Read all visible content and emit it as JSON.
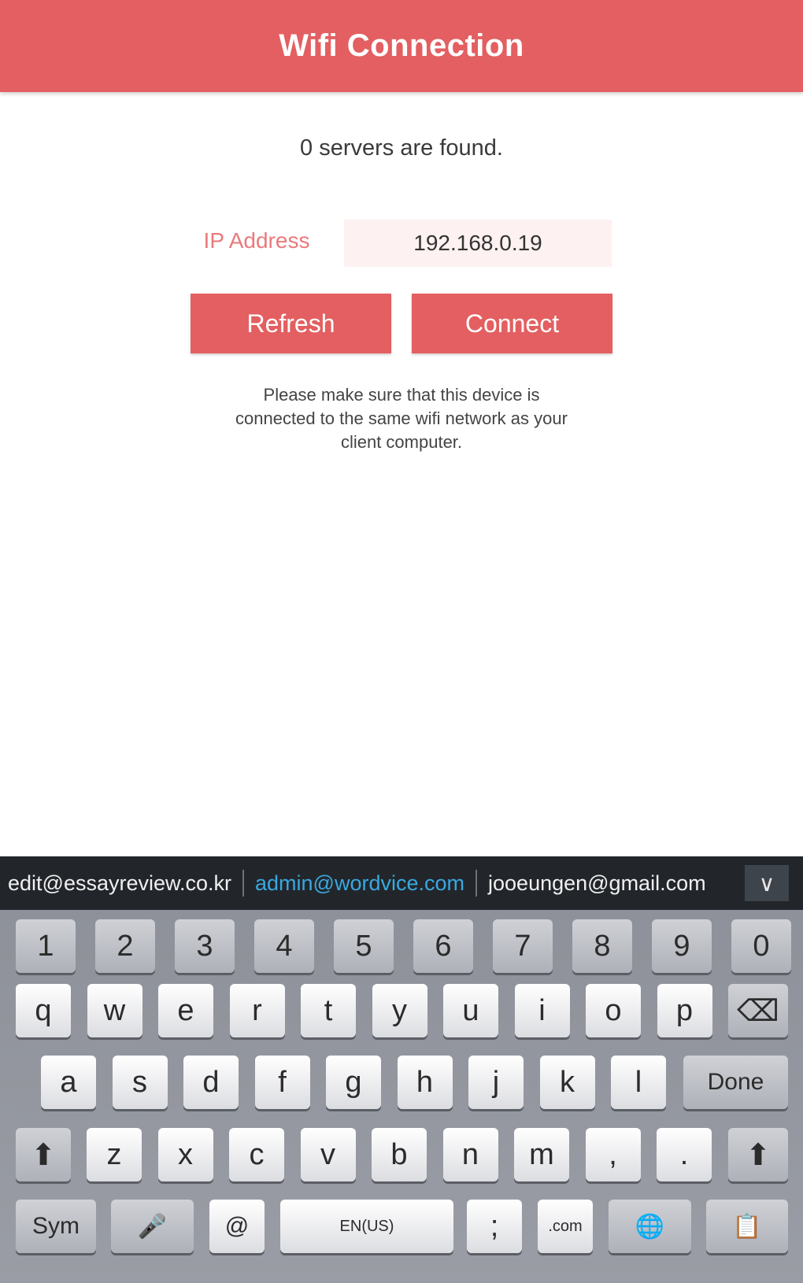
{
  "header": {
    "title": "Wifi Connection"
  },
  "status": {
    "servers_found": "0 servers are found."
  },
  "ip": {
    "label": "IP Address",
    "value": "192.168.0.19"
  },
  "buttons": {
    "refresh": "Refresh",
    "connect": "Connect"
  },
  "hint": "Please make sure that this device is connected to the same wifi network as your client computer.",
  "keyboard": {
    "suggestions": [
      "edit@essayreview.co.kr",
      "admin@wordvice.com",
      "jooeungen@gmail.com"
    ],
    "active_suggestion_index": 1,
    "suggestion_toggle": "∨",
    "row_numbers": [
      "1",
      "2",
      "3",
      "4",
      "5",
      "6",
      "7",
      "8",
      "9",
      "0"
    ],
    "row_top": [
      "q",
      "w",
      "e",
      "r",
      "t",
      "y",
      "u",
      "i",
      "o",
      "p"
    ],
    "row_home": [
      "a",
      "s",
      "d",
      "f",
      "g",
      "h",
      "j",
      "k",
      "l"
    ],
    "row_bottom": [
      "z",
      "x",
      "c",
      "v",
      "b",
      "n",
      "m",
      ",",
      "."
    ],
    "backspace": "⌫",
    "done": "Done",
    "shift": "⬆",
    "sym": "Sym",
    "mic": "🎤",
    "at": "@",
    "space_label": "EN(US)",
    "semicolon": ";",
    "dotcom": ".com",
    "globe": "🌐",
    "clipboard": "📋"
  }
}
